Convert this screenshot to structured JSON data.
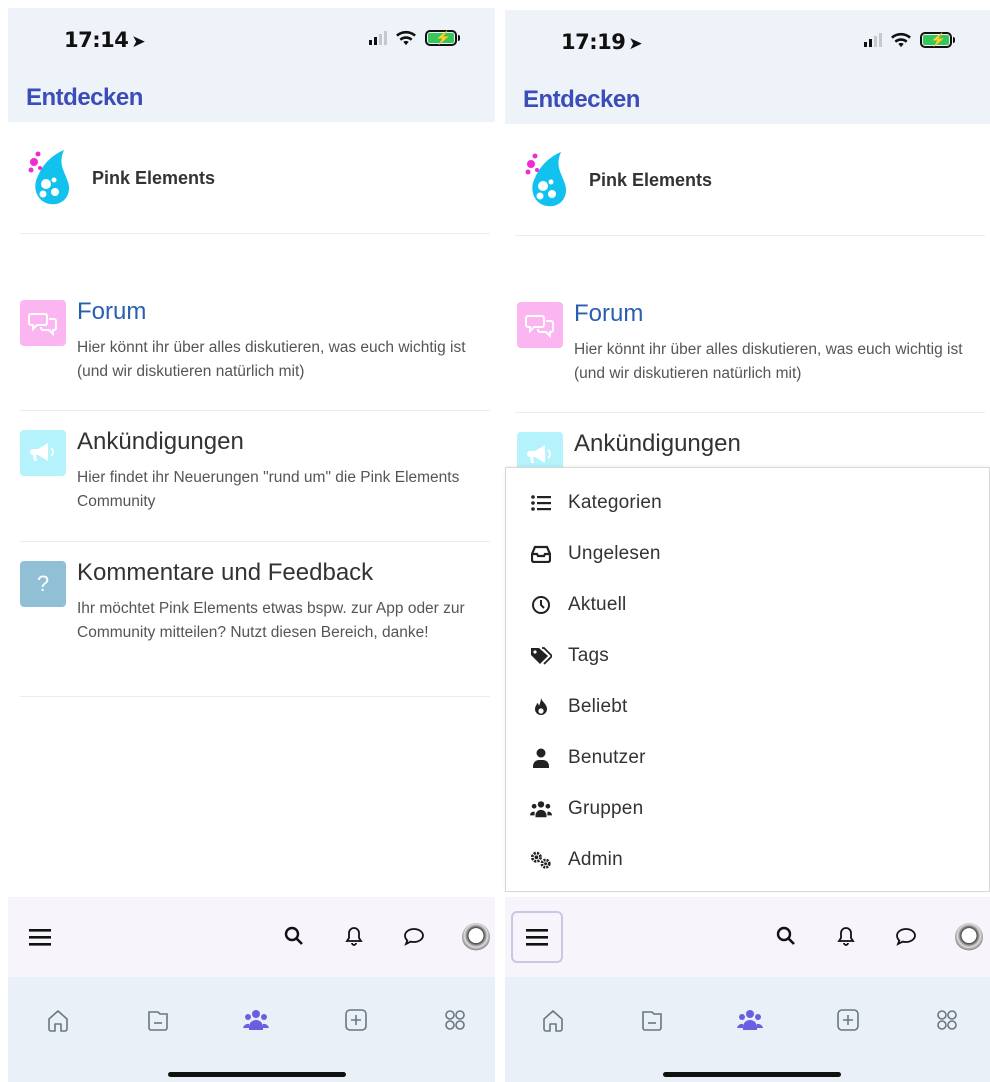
{
  "colors": {
    "header_bg": "#eef2f9",
    "header_title": "#3a4db8",
    "forum_icon_bg": "#fbb6f2",
    "announce_icon_bg": "#b4f3fb",
    "feedback_icon_bg": "#91bfd6",
    "forum_title": "#2a5fb0",
    "active_tab": "#6a5fe0"
  },
  "left": {
    "status": {
      "time": "17:14"
    },
    "header": {
      "title": "Entdecken"
    },
    "brand": {
      "name": "Pink Elements",
      "logo_icon": "pink-elements-logo"
    },
    "categories": [
      {
        "title": "Forum",
        "description": "Hier könnt ihr über alles diskutieren, was euch wichtig ist (und wir diskutieren natürlich mit)",
        "icon": "chat-bubbles-icon"
      },
      {
        "title": "Ankündigungen",
        "description": "Hier findet ihr Neuerungen \"rund um\" die Pink Elements Community",
        "icon": "megaphone-icon"
      },
      {
        "title": "Kommentare und Feedback",
        "description": "Ihr möchtet Pink Elements etwas bspw. zur App oder zur Community mitteilen? Nutzt diesen Bereich, danke!",
        "icon_text": "?",
        "icon": "question-icon"
      }
    ]
  },
  "right": {
    "status": {
      "time": "17:19"
    },
    "header": {
      "title": "Entdecken"
    },
    "brand": {
      "name": "Pink Elements",
      "logo_icon": "pink-elements-logo"
    },
    "categories": [
      {
        "title": "Forum",
        "description": "Hier könnt ihr über alles diskutieren, was euch wichtig ist (und wir diskutieren natürlich mit)",
        "icon": "chat-bubbles-icon"
      },
      {
        "title": "Ankündigungen",
        "icon": "megaphone-icon"
      }
    ],
    "menu": [
      {
        "label": "Kategorien",
        "icon": "list-icon"
      },
      {
        "label": "Ungelesen",
        "icon": "inbox-icon"
      },
      {
        "label": "Aktuell",
        "icon": "clock-icon"
      },
      {
        "label": "Tags",
        "icon": "tags-icon"
      },
      {
        "label": "Beliebt",
        "icon": "fire-icon"
      },
      {
        "label": "Benutzer",
        "icon": "user-icon"
      },
      {
        "label": "Gruppen",
        "icon": "users-icon"
      },
      {
        "label": "Admin",
        "icon": "cogs-icon"
      }
    ]
  },
  "bottom_bar": {
    "icons": [
      "hamburger-icon",
      "search-icon",
      "bell-icon",
      "chat-icon",
      "avatar"
    ]
  },
  "tab_bar": {
    "tabs": [
      "home-icon",
      "tray-icon",
      "community-icon",
      "plus-square-icon",
      "apps-grid-icon"
    ],
    "active": "community-icon"
  }
}
